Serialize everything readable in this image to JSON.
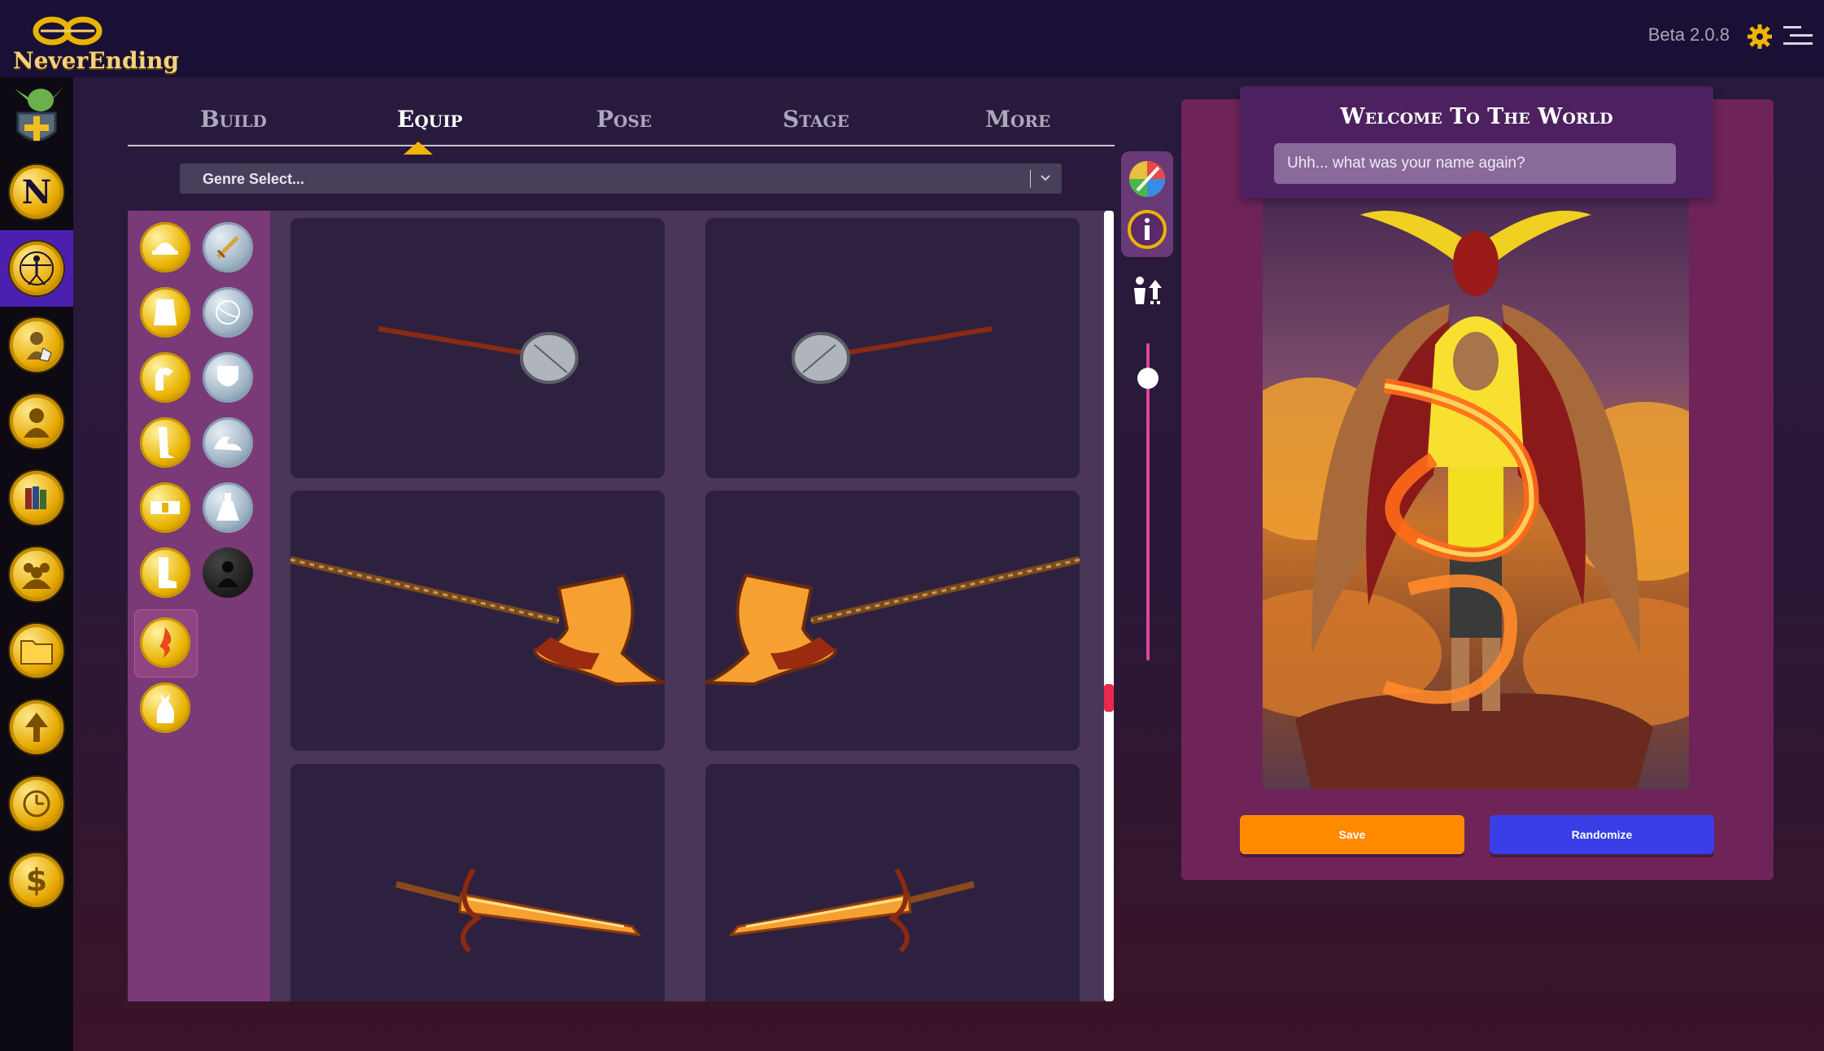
{
  "app": {
    "logo_text": "NeverEnding",
    "version": "Beta 2.0.8"
  },
  "topbar": {
    "settings_icon": "gear-icon",
    "menu_icon": "menu-icon"
  },
  "leftnav": {
    "items": [
      {
        "name": "character-creator",
        "icon": "goblin-shield-icon"
      },
      {
        "name": "neverending",
        "icon": "n-coin-icon"
      },
      {
        "name": "vitruvian",
        "icon": "vitruvian-man-icon",
        "active": true
      },
      {
        "name": "hero-dice",
        "icon": "warrior-dice-icon"
      },
      {
        "name": "profile",
        "icon": "person-icon"
      },
      {
        "name": "library",
        "icon": "books-icon"
      },
      {
        "name": "group",
        "icon": "group-icon"
      },
      {
        "name": "folder",
        "icon": "folder-icon"
      },
      {
        "name": "upgrade",
        "icon": "arrow-up-icon"
      },
      {
        "name": "history",
        "icon": "clock-icon"
      },
      {
        "name": "shop",
        "icon": "dollar-icon"
      }
    ]
  },
  "tabs": [
    {
      "label": "Build"
    },
    {
      "label": "Equip",
      "active": true
    },
    {
      "label": "Pose"
    },
    {
      "label": "Stage"
    },
    {
      "label": "More"
    }
  ],
  "genre_select": {
    "value": "Genre Select..."
  },
  "categories": {
    "left": [
      "helmet-icon",
      "torso-icon",
      "arm-icon",
      "leg-icon",
      "belt-icon",
      "boot-icon",
      "fire-spell-icon",
      "cat-pet-icon"
    ],
    "right": [
      "sword-icon",
      "globe-icon",
      "shield-icon",
      "wave-icon",
      "potion-icon",
      "silhouette-icon"
    ],
    "selected": "fire-spell-icon"
  },
  "items": [
    {
      "name": "hammer-left"
    },
    {
      "name": "hammer-right"
    },
    {
      "name": "axe-left"
    },
    {
      "name": "axe-right"
    },
    {
      "name": "flame-sword-left"
    },
    {
      "name": "flame-sword-right"
    }
  ],
  "tools": {
    "palette_icon": "palette-icon",
    "info_icon": "info-icon",
    "pose_icon": "pose-swap-icon"
  },
  "welcome": {
    "title": "Welcome To The World",
    "name_placeholder": "Uhh... what was your name again?"
  },
  "buttons": {
    "save": "Save",
    "randomize": "Randomize"
  },
  "colors": {
    "accent_gold": "#f0b400",
    "save_orange": "#ff8a00",
    "randomize_blue": "#3a3ee6",
    "card": "#6e2458"
  }
}
